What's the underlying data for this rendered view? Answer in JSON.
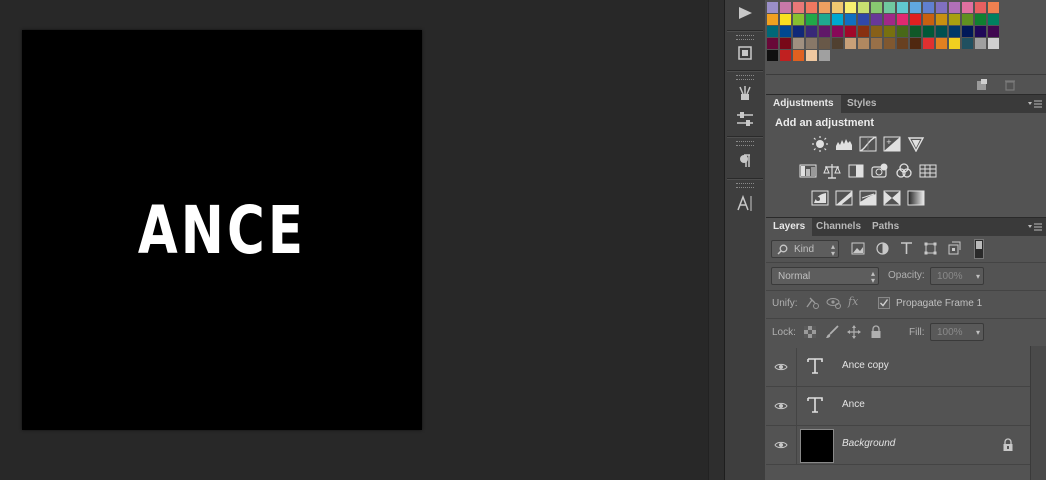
{
  "canvas": {
    "text": "ANCE"
  },
  "adjustments_panel": {
    "tabs": [
      {
        "label": "Adjustments"
      },
      {
        "label": "Styles"
      }
    ],
    "heading": "Add an adjustment"
  },
  "layers_panel": {
    "tabs": [
      {
        "label": "Layers"
      },
      {
        "label": "Channels"
      },
      {
        "label": "Paths"
      }
    ],
    "filter_kind": "Kind",
    "blend_mode": "Normal",
    "opacity_label": "Opacity:",
    "opacity_value": "100%",
    "unify_label": "Unify:",
    "propagate_label": "Propagate Frame 1",
    "lock_label": "Lock:",
    "fill_label": "Fill:",
    "fill_value": "100%",
    "layers": [
      {
        "name": "Ance copy",
        "type": "text"
      },
      {
        "name": "Ance",
        "type": "text"
      },
      {
        "name": "Background",
        "type": "image"
      }
    ]
  },
  "swatches": {
    "row1": [
      "#9a8fc8",
      "#c878a8",
      "#e87878",
      "#f07860",
      "#f0a060",
      "#f0c870",
      "#f8f070",
      "#c8e070",
      "#88c870",
      "#70c8a0",
      "#60c8d0",
      "#60a8e0",
      "#6080d0",
      "#8070c0",
      "#b070b8",
      "#e070a0",
      "#e86060",
      "#f08050"
    ],
    "row2": [
      "#f0a020",
      "#f8e020",
      "#88c030",
      "#20a848",
      "#20a890",
      "#00a8d0",
      "#1070c0",
      "#3048a8",
      "#683898",
      "#a02888",
      "#e02870",
      "#e02020",
      "#c86010",
      "#c89010",
      "#a8a010",
      "#609020",
      "#108030",
      "#008060"
    ],
    "row3": [
      "#006878",
      "#004890",
      "#102878",
      "#382878",
      "#601868",
      "#880858",
      "#a00828",
      "#883010",
      "#886018",
      "#787010",
      "#486818",
      "#105828",
      "#005838",
      "#005050",
      "#003868",
      "#001858",
      "#200858",
      "#400850"
    ],
    "row4": [
      "#680838",
      "#780818",
      "#a09080",
      "#887868",
      "#685848",
      "#504030",
      "#c8a078",
      "#b08860",
      "#987048",
      "#805830",
      "#684020",
      "#502810",
      "#e03030",
      "#e08020",
      "#f0d020",
      "#205060",
      "#a0a0a0",
      "#d0d0d0"
    ],
    "row5": [
      "#101010",
      "#c02020",
      "#e06020",
      "#f0c8a0",
      "#a0a0a0"
    ],
    "row4_extra": [
      "#e0c8a8"
    ]
  }
}
